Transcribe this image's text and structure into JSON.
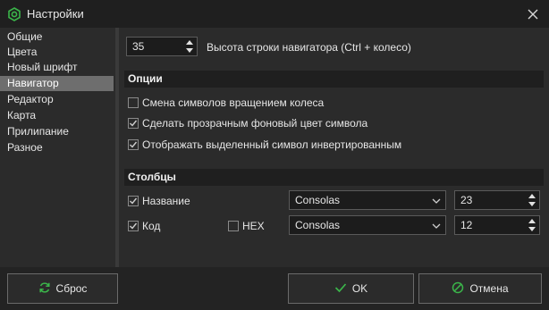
{
  "window": {
    "title": "Настройки",
    "icon": "gear-icon",
    "accent": "#3bb54a"
  },
  "sidebar": {
    "items": [
      {
        "label": "Общие"
      },
      {
        "label": "Цвета"
      },
      {
        "label": "Новый шрифт"
      },
      {
        "label": "Навигатор",
        "selected": true
      },
      {
        "label": "Редактор"
      },
      {
        "label": "Карта"
      },
      {
        "label": "Прилипание"
      },
      {
        "label": "Разное"
      }
    ],
    "selected_color": "#6e6e6e"
  },
  "navigator": {
    "row_height": "35",
    "row_height_label": "Высота строки навигатора (Ctrl + колесо)"
  },
  "options": {
    "heading": "Опции",
    "items": [
      {
        "label": "Смена символов вращением колеса",
        "checked": false
      },
      {
        "label": "Сделать прозрачным фоновый цвет символа",
        "checked": true
      },
      {
        "label": "Отображать выделенный символ инвертированным",
        "checked": true
      }
    ]
  },
  "columns": {
    "heading": "Столбцы",
    "rows": [
      {
        "label": "Название",
        "checked": true,
        "font": "Consolas",
        "size": "23"
      },
      {
        "label": "Код",
        "checked": true,
        "font": "Consolas",
        "size": "12"
      }
    ],
    "hex": {
      "label": "HEX",
      "checked": false
    }
  },
  "footer": {
    "reset_label": "Сброс",
    "ok_label": "OK",
    "cancel_label": "Отмена"
  }
}
